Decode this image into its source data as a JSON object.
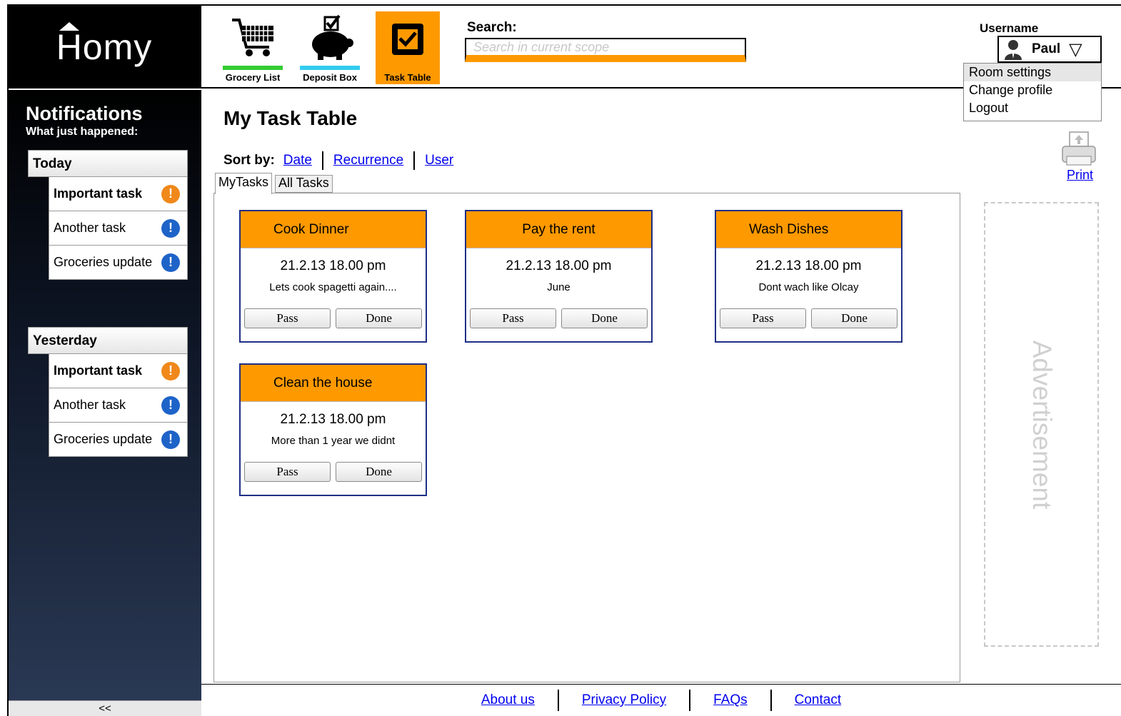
{
  "app": {
    "logo": "Homy"
  },
  "nav": [
    {
      "label": "Grocery List",
      "bar_color": "#33cc33",
      "icon": "shopping-cart-icon"
    },
    {
      "label": "Deposit Box",
      "bar_color": "#33ccee",
      "icon": "piggy-bank-icon"
    },
    {
      "label": "Task Table",
      "icon": "task-checkbox-icon",
      "active": true,
      "active_color": "#ff9900"
    }
  ],
  "search": {
    "label": "Search:",
    "placeholder": "Search in current scope"
  },
  "user": {
    "label": "Username",
    "name": "Paul",
    "menu": [
      "Room settings",
      "Change profile",
      "Logout"
    ]
  },
  "sidebar": {
    "title": "Notifications",
    "subtitle": "What just happened:",
    "groups": [
      {
        "title": "Today",
        "items": [
          {
            "label": "Important task",
            "icon": "exclamation-icon",
            "color": "#f0881a"
          },
          {
            "label": "Another task",
            "icon": "exclamation-icon",
            "color": "#1e63c8"
          },
          {
            "label": "Groceries update",
            "icon": "exclamation-icon",
            "color": "#1e63c8"
          }
        ]
      },
      {
        "title": "Yesterday",
        "items": [
          {
            "label": "Important task",
            "icon": "exclamation-icon",
            "color": "#f0881a"
          },
          {
            "label": "Another task",
            "icon": "exclamation-icon",
            "color": "#1e63c8"
          },
          {
            "label": "Groceries update",
            "icon": "exclamation-icon",
            "color": "#1e63c8"
          }
        ]
      }
    ],
    "collapse": "<<"
  },
  "main": {
    "title": "My Task Table",
    "sort": {
      "label": "Sort by:",
      "options": [
        "Date",
        "Recurrence",
        "User"
      ]
    },
    "tabs": [
      "MyTasks",
      "All Tasks"
    ],
    "tasks": [
      {
        "title": "Cook Dinner",
        "date": "21.2.13 18.00 pm",
        "note": "Lets cook spagetti again....",
        "pass": "Pass",
        "done": "Done"
      },
      {
        "title": "Pay the rent",
        "date": "21.2.13 18.00 pm",
        "note": "June",
        "pass": "Pass",
        "done": "Done"
      },
      {
        "title": "Wash Dishes",
        "date": "21.2.13 18.00 pm",
        "note": "Dont wach like Olcay",
        "pass": "Pass",
        "done": "Done"
      },
      {
        "title": "Clean the house",
        "date": "21.2.13 18.00 pm",
        "note": "More than 1 year we didnt",
        "pass": "Pass",
        "done": "Done"
      }
    ]
  },
  "print": {
    "label": "Print"
  },
  "advertisement": {
    "label": "Advertisement"
  },
  "footer": {
    "links": [
      "About us",
      "Privacy Policy",
      "FAQs",
      "Contact"
    ]
  }
}
